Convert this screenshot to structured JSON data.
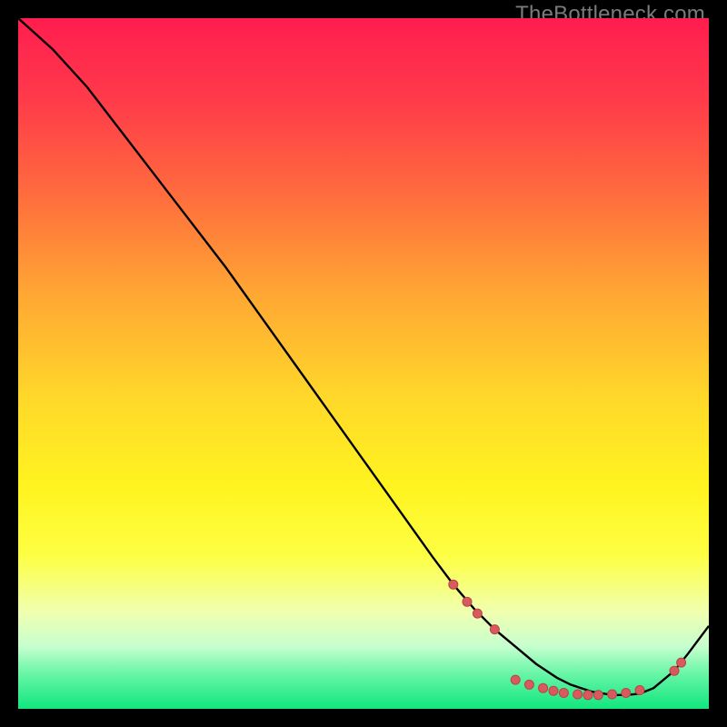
{
  "watermark": "TheBottleneck.com",
  "chart_data": {
    "type": "line",
    "title": "",
    "xlabel": "",
    "ylabel": "",
    "xlim": [
      0,
      100
    ],
    "ylim": [
      0,
      100
    ],
    "grid": false,
    "legend": false,
    "background_gradient": {
      "stops": [
        {
          "offset": 0.0,
          "color": "#ff1d4f"
        },
        {
          "offset": 0.12,
          "color": "#ff3b4a"
        },
        {
          "offset": 0.25,
          "color": "#ff6a3e"
        },
        {
          "offset": 0.4,
          "color": "#ffa733"
        },
        {
          "offset": 0.55,
          "color": "#ffd82a"
        },
        {
          "offset": 0.68,
          "color": "#fff41f"
        },
        {
          "offset": 0.78,
          "color": "#fdff45"
        },
        {
          "offset": 0.86,
          "color": "#f0ffb0"
        },
        {
          "offset": 0.91,
          "color": "#c6ffcf"
        },
        {
          "offset": 0.95,
          "color": "#66f5a6"
        },
        {
          "offset": 1.0,
          "color": "#11e67e"
        }
      ]
    },
    "curve": {
      "x": [
        0,
        5,
        10,
        15,
        20,
        25,
        30,
        35,
        40,
        45,
        50,
        55,
        60,
        63,
        66,
        69,
        72,
        75,
        78,
        80,
        83,
        86,
        88,
        90,
        92,
        95,
        97,
        100
      ],
      "y": [
        100,
        95.5,
        90.0,
        83.5,
        77.0,
        70.5,
        64.0,
        57.0,
        50.0,
        43.0,
        36.0,
        29.0,
        22.0,
        18.0,
        14.5,
        11.5,
        9.0,
        6.5,
        4.5,
        3.5,
        2.5,
        2.0,
        2.0,
        2.2,
        3.0,
        5.5,
        8.0,
        12.0
      ]
    },
    "markers": {
      "style": {
        "shape": "circle",
        "size": 10,
        "fill": "#d85a5e",
        "stroke": "#b84448"
      },
      "points": [
        {
          "x": 63,
          "y": 18.0
        },
        {
          "x": 65,
          "y": 15.5
        },
        {
          "x": 66.5,
          "y": 13.8
        },
        {
          "x": 69,
          "y": 11.5
        },
        {
          "x": 72,
          "y": 4.2
        },
        {
          "x": 74,
          "y": 3.5
        },
        {
          "x": 76,
          "y": 3.0
        },
        {
          "x": 77.5,
          "y": 2.6
        },
        {
          "x": 79,
          "y": 2.3
        },
        {
          "x": 81,
          "y": 2.1
        },
        {
          "x": 82.5,
          "y": 2.0
        },
        {
          "x": 84,
          "y": 2.0
        },
        {
          "x": 86,
          "y": 2.1
        },
        {
          "x": 88,
          "y": 2.3
        },
        {
          "x": 90,
          "y": 2.7
        },
        {
          "x": 95,
          "y": 5.5
        },
        {
          "x": 96,
          "y": 6.7
        }
      ]
    }
  }
}
